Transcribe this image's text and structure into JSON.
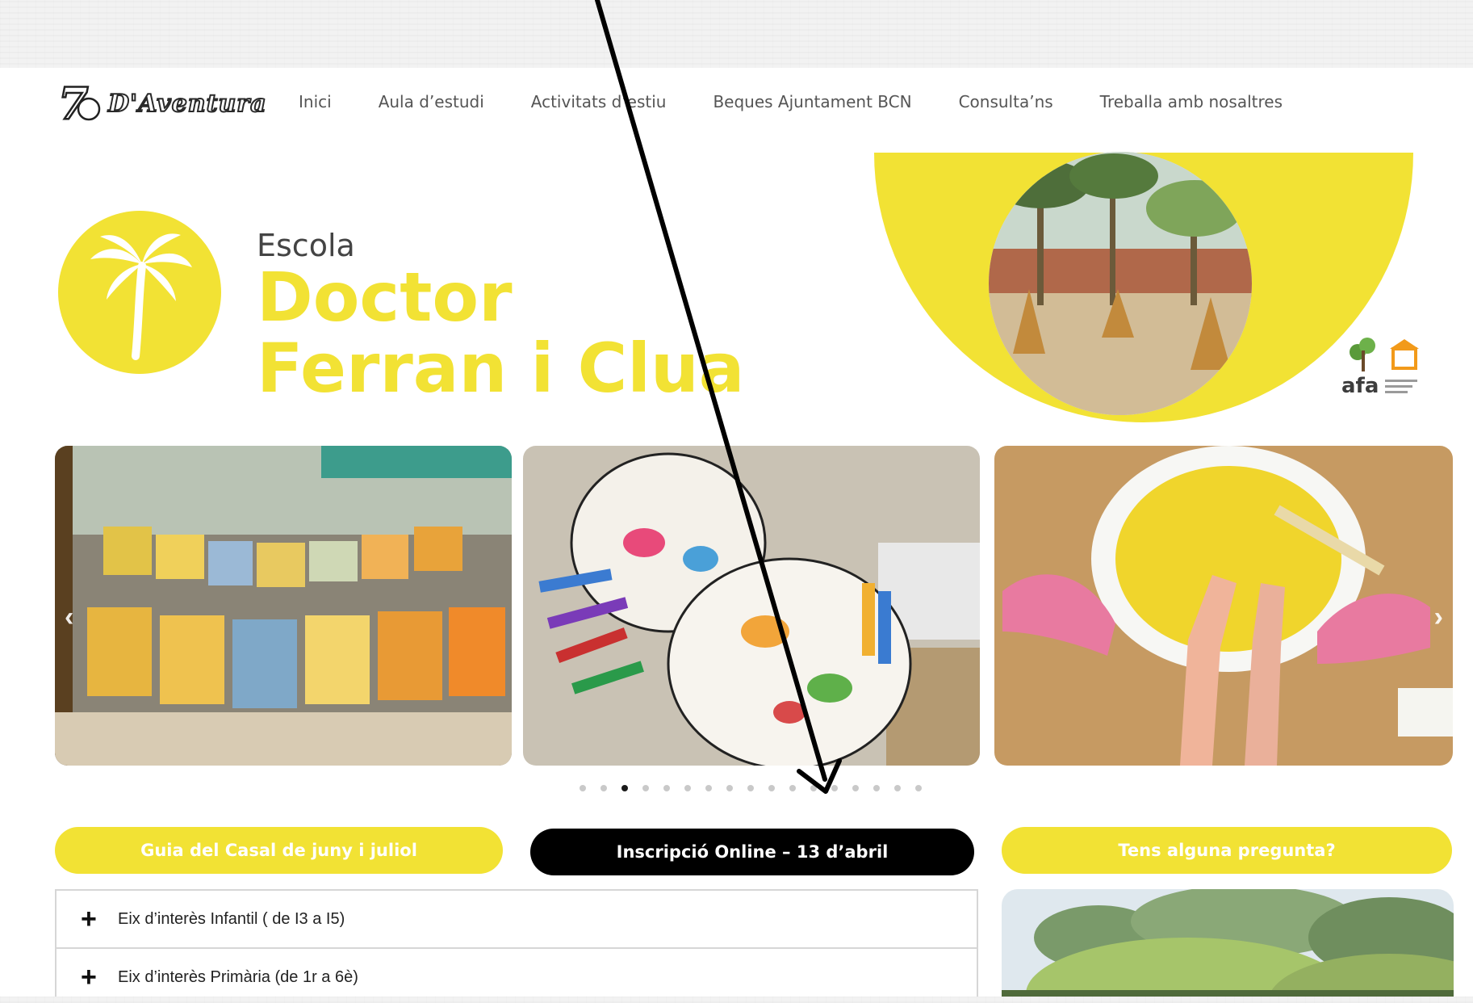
{
  "logo": {
    "text": "D'Aventura",
    "mark": "7"
  },
  "nav": {
    "items": [
      {
        "label": "Inici"
      },
      {
        "label": "Aula d’estudi"
      },
      {
        "label": "Activitats d’estiu"
      },
      {
        "label": "Beques Ajuntament BCN"
      },
      {
        "label": "Consulta’ns"
      },
      {
        "label": "Treballa amb nosaltres"
      }
    ]
  },
  "hero": {
    "escola": "Escola",
    "name_line1": "Doctor",
    "name_line2": "Ferran i Clua",
    "partner_logo": "afa"
  },
  "carousel": {
    "prev_icon": "chevron-left-icon",
    "next_icon": "chevron-right-icon",
    "dot_count": 17,
    "active_dot": 3
  },
  "buttons": {
    "guide": "Guia del Casal de juny i juliol",
    "signup": "Inscripció Online – 13 d’abril",
    "question": "Tens alguna pregunta?"
  },
  "accordion": {
    "items": [
      {
        "label": "Eix d’interès Infantil ( de I3 a I5)"
      },
      {
        "label": "Eix d’interès Primària (de 1r a 6è)"
      }
    ]
  },
  "colors": {
    "accent": "#f2e234",
    "dark": "#000000",
    "text": "#555555"
  }
}
